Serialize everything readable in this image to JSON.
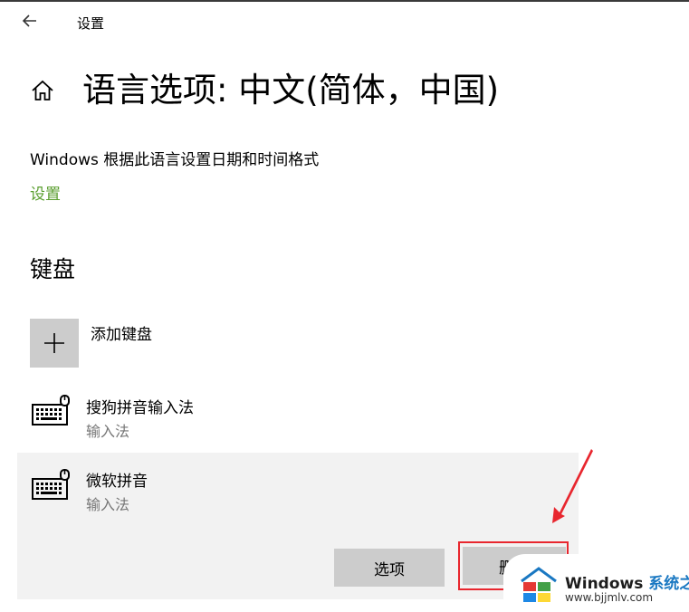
{
  "titlebar": {
    "title": "设置"
  },
  "page": {
    "title": "语言选项: 中文(简体，中国)"
  },
  "regional": {
    "description": "Windows 根据此语言设置日期和时间格式",
    "settings_link": "设置"
  },
  "keyboard": {
    "heading": "键盘",
    "add_label": "添加键盘",
    "items": [
      {
        "name": "搜狗拼音输入法",
        "type": "输入法"
      },
      {
        "name": "微软拼音",
        "type": "输入法"
      }
    ],
    "options_button": "选项",
    "remove_button": "删除"
  },
  "watermark": {
    "brand": "Windows",
    "brand_suffix": "系统之家",
    "url": "www.bjjmlv.com"
  },
  "colors": {
    "accent_green": "#5a9e2f",
    "highlight_red": "#e8262e",
    "tile_gray": "#cccccc",
    "panel_gray": "#f2f2f2"
  }
}
